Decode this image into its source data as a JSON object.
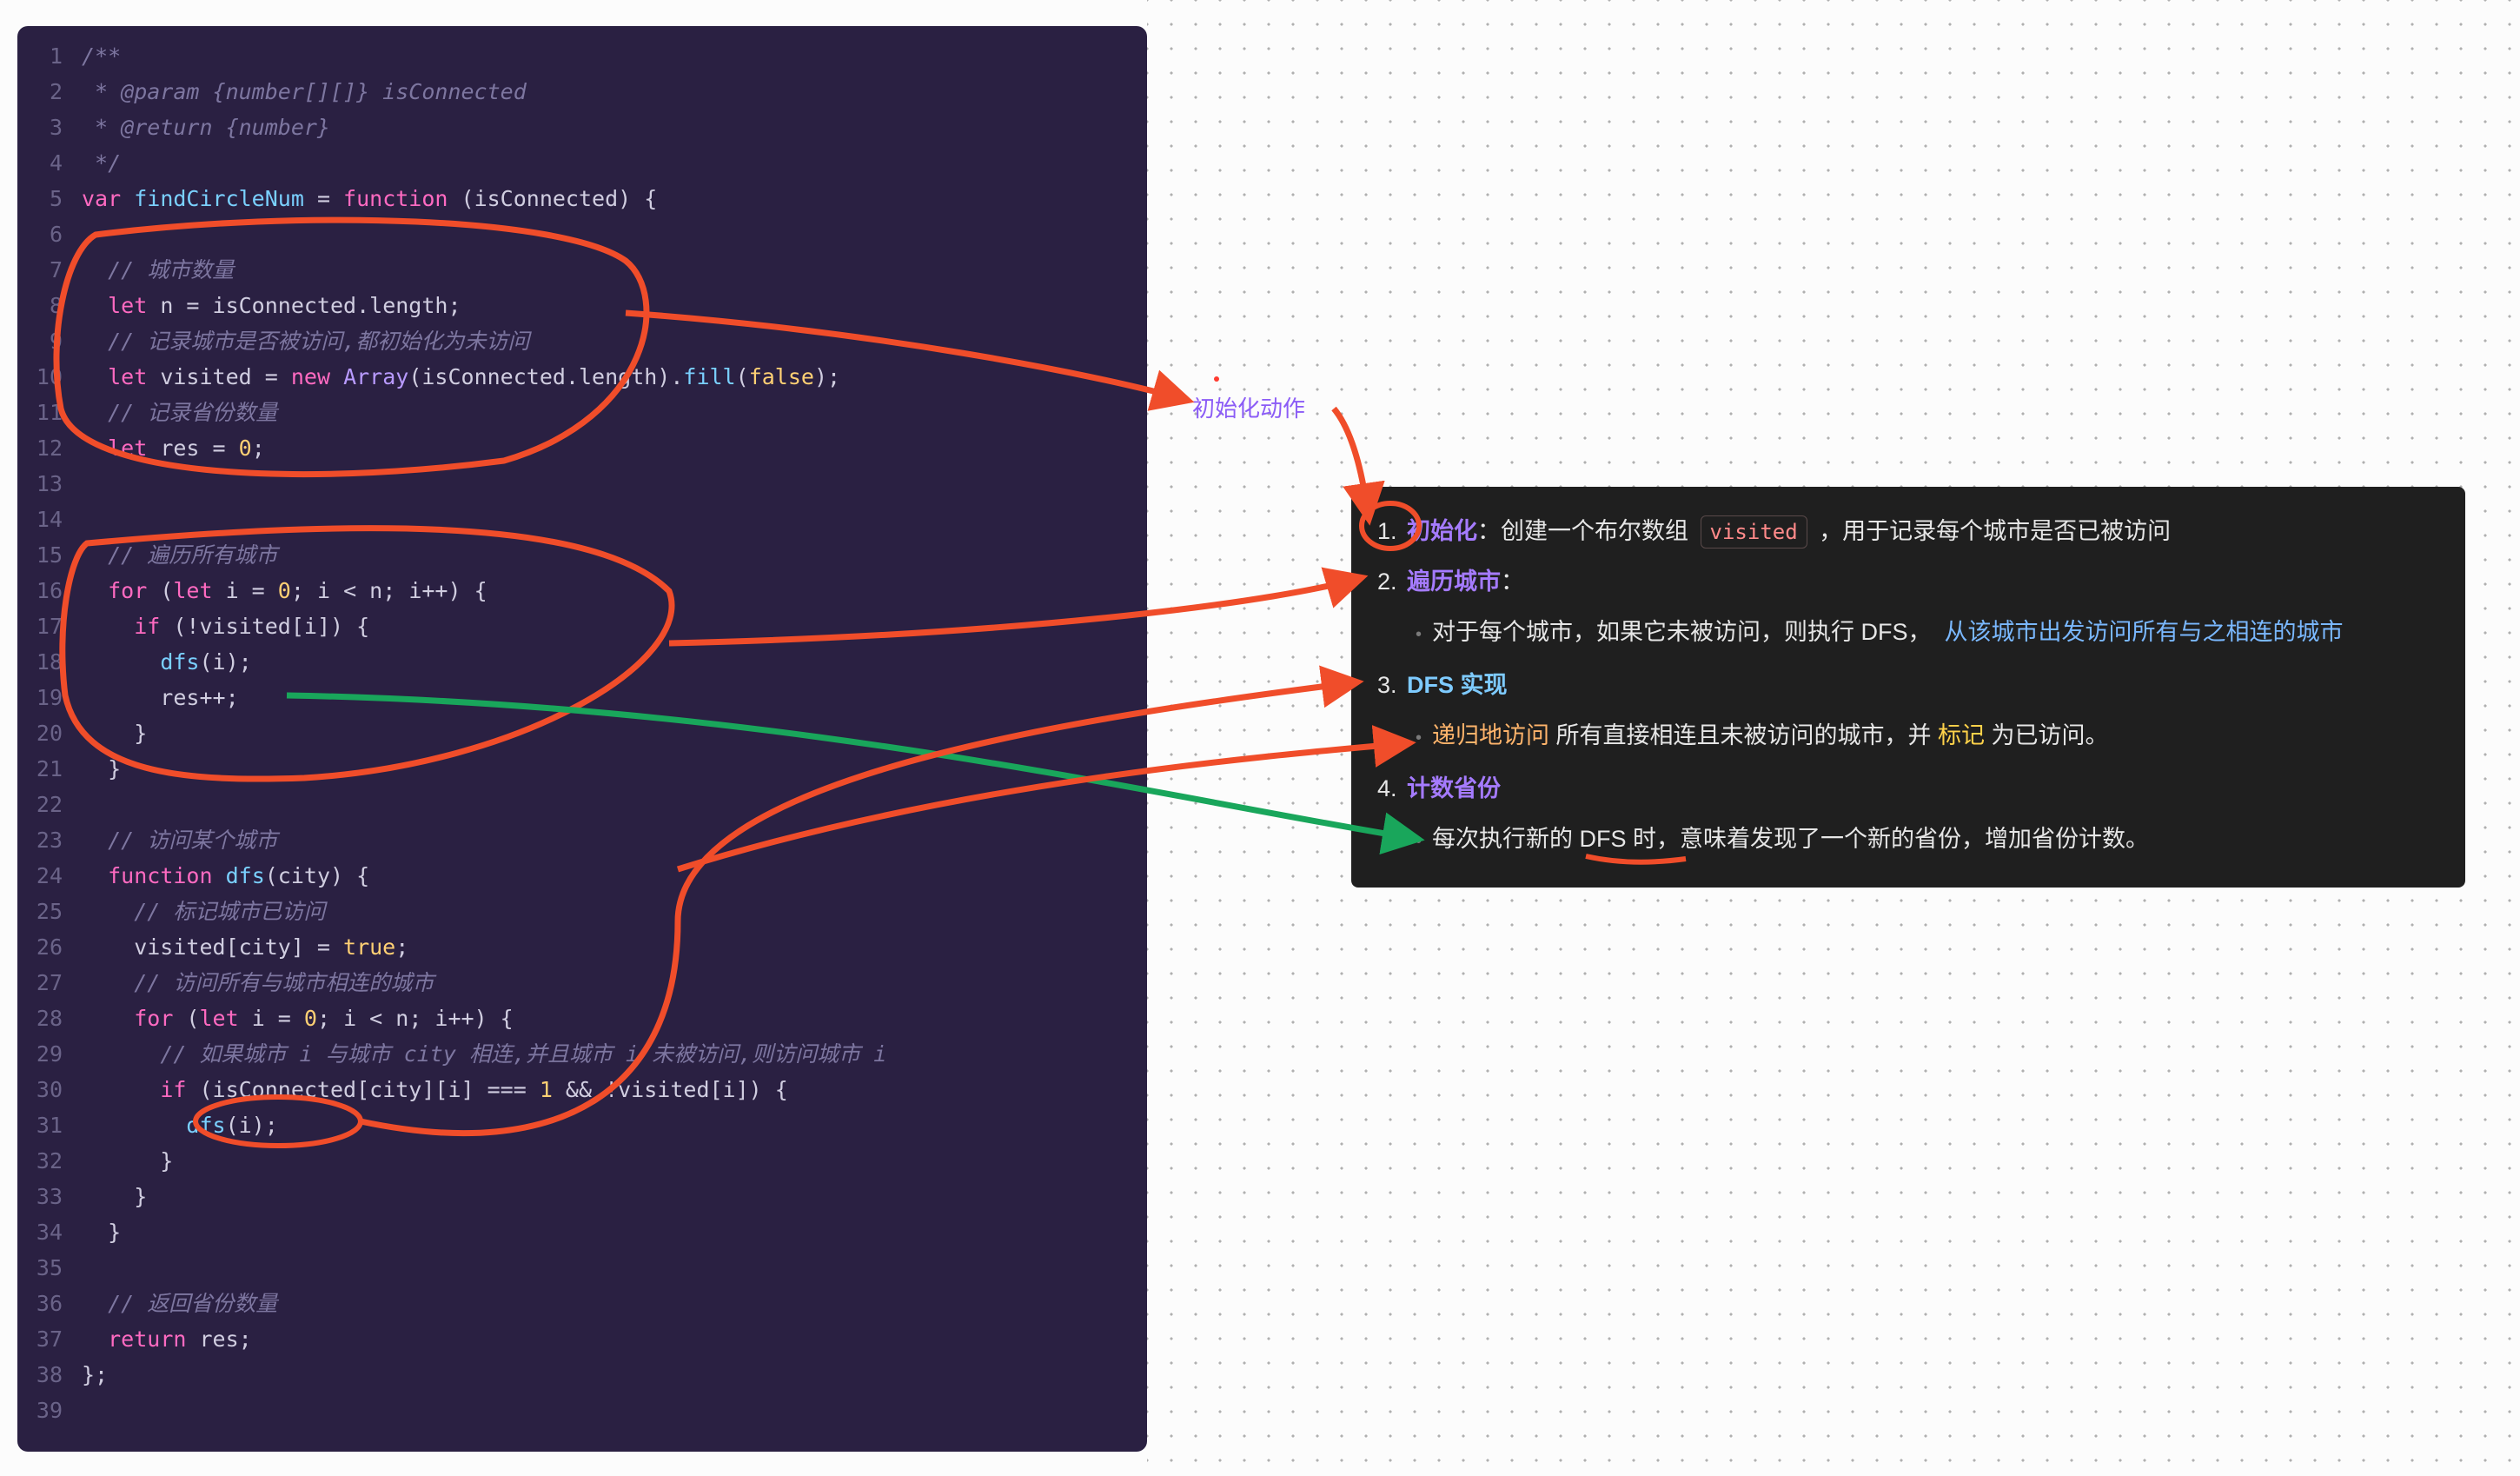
{
  "label_init": "初始化动作",
  "code": {
    "lines": [
      {
        "n": 1,
        "html": "<span class='c-comment'>/**</span>"
      },
      {
        "n": 2,
        "html": "<span class='c-comment'> * @param {number[][]} isConnected</span>"
      },
      {
        "n": 3,
        "html": "<span class='c-comment'> * @return {number}</span>"
      },
      {
        "n": 4,
        "html": "<span class='c-comment'> */</span>"
      },
      {
        "n": 5,
        "html": "<span class='c-kw'>var</span> <span class='c-fn'>findCircleNum</span> = <span class='c-kw'>function</span> (isConnected) {"
      },
      {
        "n": 6,
        "html": ""
      },
      {
        "n": 7,
        "html": "  <span class='c-comment'>// 城市数量</span>"
      },
      {
        "n": 8,
        "html": "  <span class='c-kw'>let</span> n = isConnected.length;"
      },
      {
        "n": 9,
        "html": "  <span class='c-comment'>// 记录城市是否被访问,都初始化为未访问</span>"
      },
      {
        "n": 10,
        "html": "  <span class='c-kw'>let</span> visited = <span class='c-kw'>new</span> <span class='c-type'>Array</span>(isConnected.length).<span class='c-fn'>fill</span>(<span class='c-bool'>false</span>);"
      },
      {
        "n": 11,
        "html": "  <span class='c-comment'>// 记录省份数量</span>"
      },
      {
        "n": 12,
        "html": "  <span class='c-kw'>let</span> res = <span class='c-num'>0</span>;"
      },
      {
        "n": 13,
        "html": ""
      },
      {
        "n": 14,
        "html": ""
      },
      {
        "n": 15,
        "html": "  <span class='c-comment'>// 遍历所有城市</span>"
      },
      {
        "n": 16,
        "html": "  <span class='c-kw'>for</span> (<span class='c-kw'>let</span> i = <span class='c-num'>0</span>; i &lt; n; i++) {"
      },
      {
        "n": 17,
        "html": "    <span class='c-kw'>if</span> (!visited[i]) {"
      },
      {
        "n": 18,
        "html": "      <span class='c-fn'>dfs</span>(i);"
      },
      {
        "n": 19,
        "html": "      res++;"
      },
      {
        "n": 20,
        "html": "    }"
      },
      {
        "n": 21,
        "html": "  }"
      },
      {
        "n": 22,
        "html": ""
      },
      {
        "n": 23,
        "html": "  <span class='c-comment'>// 访问某个城市</span>"
      },
      {
        "n": 24,
        "html": "  <span class='c-kw'>function</span> <span class='c-fn'>dfs</span>(city) {"
      },
      {
        "n": 25,
        "html": "    <span class='c-comment'>// 标记城市已访问</span>"
      },
      {
        "n": 26,
        "html": "    visited[city] = <span class='c-bool'>true</span>;"
      },
      {
        "n": 27,
        "html": "    <span class='c-comment'>// 访问所有与城市相连的城市</span>"
      },
      {
        "n": 28,
        "html": "    <span class='c-kw'>for</span> (<span class='c-kw'>let</span> i = <span class='c-num'>0</span>; i &lt; n; i++) {"
      },
      {
        "n": 29,
        "html": "      <span class='c-comment'>// 如果城市 i 与城市 city 相连,并且城市 i 未被访问,则访问城市 i</span>"
      },
      {
        "n": 30,
        "html": "      <span class='c-kw'>if</span> (isConnected[city][i] === <span class='c-num'>1</span> &amp;&amp; !visited[i]) {"
      },
      {
        "n": 31,
        "html": "        <span class='c-fn'>dfs</span>(i);"
      },
      {
        "n": 32,
        "html": "      }"
      },
      {
        "n": 33,
        "html": "    }"
      },
      {
        "n": 34,
        "html": "  }"
      },
      {
        "n": 35,
        "html": ""
      },
      {
        "n": 36,
        "html": "  <span class='c-comment'>// 返回省份数量</span>"
      },
      {
        "n": 37,
        "html": "  <span class='c-kw'>return</span> res;"
      },
      {
        "n": 38,
        "html": "};"
      },
      {
        "n": 39,
        "html": ""
      }
    ]
  },
  "info": {
    "items": [
      {
        "num": "1.",
        "key": "初始化",
        "key_color": "ip-key1",
        "rest_html": "<span style='color:#e6e6e6'>：创建一个布尔数组</span> <span class='ip-code'>visited</span> <span style='color:#e6e6e6'>，用于记录每个城市是否已被访问</span>",
        "sub": null
      },
      {
        "num": "2.",
        "key": "遍历城市",
        "key_color": "ip-key1",
        "rest_html": "：",
        "sub": "<span class='ip-bullet'>•</span><span>对于每个城市，如果它未被访问，则执行 DFS，&nbsp;&nbsp;<span class='ip-bluetxt'>从该城市出发访问所有与之相连的城市</span></span>"
      },
      {
        "num": "3.",
        "key": "DFS 实现",
        "key_color": "ip-key2",
        "rest_html": "",
        "sub": "<span class='ip-bullet'>•</span><span><span class='ip-orange'>递归地访问</span> 所有直接相连且未被访问的城市，并 <span class='ip-yellow'>标记</span> 为已访问。</span>"
      },
      {
        "num": "4.",
        "key": "计数省份",
        "key_color": "ip-key1",
        "rest_html": "",
        "sub": "<span class='ip-bullet'>•</span><span>每次执行新的 DFS 时，意味着发现了一个新的省份，增加省份计数。</span>"
      }
    ]
  }
}
